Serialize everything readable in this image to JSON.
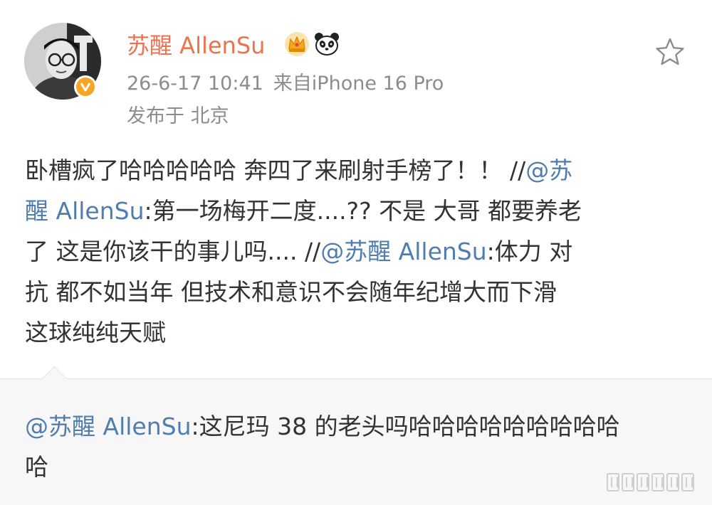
{
  "user": {
    "name": "苏醒 AllenSu",
    "verified_icon": "verified-v-icon",
    "badges": [
      "crown-icon",
      "panda-icon"
    ]
  },
  "post": {
    "date": "26-6-17",
    "time": "10:41",
    "source": "来自iPhone 16 Pro",
    "location": "发布于 北京",
    "content_lines": [
      {
        "text": "卧槽疯了哈哈哈哈哈 奔四了来刷射手榜了！！ //",
        "mention": "@苏"
      },
      {
        "mention": "醒 AllenSu",
        "text": ":第一场梅开二度....?? 不是 大哥 都要养老"
      },
      {
        "text": "了 这是你该干的事儿吗.... //",
        "mention": "@苏醒 AllenSu",
        "text2": ":体力 对"
      },
      {
        "text": "抗 都不如当年 但技术和意识不会随年纪增大而下滑"
      },
      {
        "text": "这球纯纯天赋"
      }
    ]
  },
  "repost": {
    "mention": "@苏醒 AllenSu",
    "line1": ":这尼玛 38 的老头吗哈哈哈哈哈哈哈哈哈",
    "line2": "哈"
  },
  "colors": {
    "username": "#eb7350",
    "link": "#507daf",
    "meta": "#8c8c8c",
    "text": "#333333",
    "repost_bg": "#f7f7f7"
  }
}
